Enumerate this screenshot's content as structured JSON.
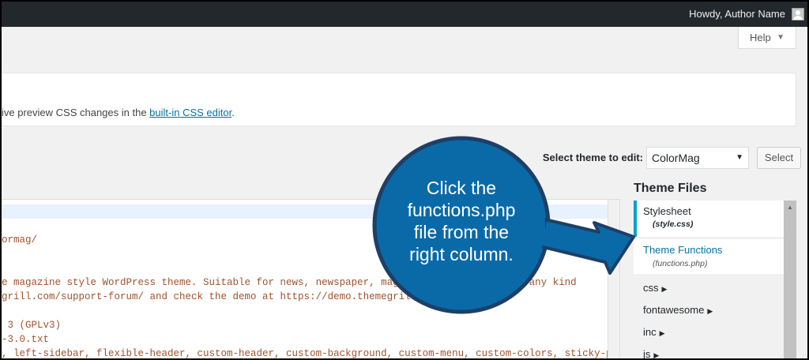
{
  "adminbar": {
    "greeting": "Howdy, Author Name"
  },
  "help": {
    "label": "Help",
    "caret": "▼"
  },
  "notice": {
    "prefix": "ive preview CSS changes in the ",
    "link": "built-in CSS editor",
    "suffix": "."
  },
  "theme_select": {
    "label": "Select theme to edit:",
    "value": "ColorMag",
    "arrow": "▼",
    "button": "Select"
  },
  "editor": {
    "lines": [
      "ormag/",
      "e magazine style WordPress theme. Suitable for news, newspaper, magazi             s and any kind",
      "grill.com/support-forum/ and check the demo at https://demo.themegrill.co",
      " 3 (GPLv3)",
      "-3.0.txt",
      ", left-sidebar, flexible-header, custom-header, custom-background, custom-menu, custom-colors, sticky-post,"
    ]
  },
  "theme_files": {
    "heading": "Theme Files",
    "files": [
      {
        "name": "Stylesheet",
        "sub": "(style.css)"
      },
      {
        "name": "Theme Functions",
        "sub": "(functions.php)"
      }
    ],
    "folders": [
      "css",
      "fontawesome",
      "inc",
      "js"
    ],
    "folder_marker": "▶",
    "scroll_up": "▲"
  },
  "callout": {
    "text": "Click the functions.php file from the right column.",
    "lines": [
      "Click the",
      "functions.php",
      "file from the",
      "right column."
    ]
  },
  "colors": {
    "adminbar": "#23282d",
    "callout_blue": "#0a6aa8",
    "callout_border": "#1e3f66",
    "link": "#0073aa",
    "active_bar": "#00a0d2",
    "code": "#a0522d"
  }
}
